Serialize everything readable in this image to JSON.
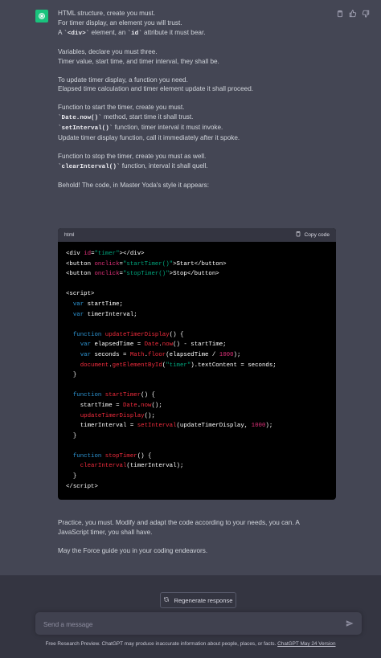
{
  "response": {
    "paragraphs": [
      [
        {
          "t": "HTML structure, create you must."
        },
        {
          "t": "For timer display, an element you will trust."
        },
        {
          "parts": [
            {
              "t": "A "
            },
            {
              "c": "`<div>`"
            },
            {
              "t": " element, an "
            },
            {
              "c": "`id`"
            },
            {
              "t": " attribute it must bear."
            }
          ]
        }
      ],
      [
        {
          "t": "Variables, declare you must three."
        },
        {
          "t": "Timer value, start time, and timer interval, they shall be."
        }
      ],
      [
        {
          "t": "To update timer display, a function you need."
        },
        {
          "t": "Elapsed time calculation and timer element update it shall proceed."
        }
      ],
      [
        {
          "t": "Function to start the timer, create you must."
        },
        {
          "parts": [
            {
              "c": "`Date.now()`"
            },
            {
              "t": " method, start time it shall trust."
            }
          ]
        },
        {
          "parts": [
            {
              "c": "`setInterval()`"
            },
            {
              "t": " function, timer interval it must invoke."
            }
          ]
        },
        {
          "t": "Update timer display function, call it immediately after it spoke."
        }
      ],
      [
        {
          "t": "Function to stop the timer, create you must as well."
        },
        {
          "parts": [
            {
              "c": "`clearInterval()`"
            },
            {
              "t": " function, interval it shall quell."
            }
          ]
        }
      ],
      [
        {
          "t": "Behold! The code, in Master Yoda's style it appears:"
        }
      ]
    ],
    "code": {
      "language": "html",
      "copy_label": "Copy code"
    },
    "after": {
      "line1": "Practice, you must. Modify and adapt the code according to your needs, you can. A",
      "line2": "JavaScript timer, you shall have.",
      "line3": "May the Force guide you in your coding endeavors."
    }
  },
  "icons": {
    "avatar": "openai-logo-icon",
    "copy": "clipboard-icon",
    "thumbs_up": "thumbs-up-icon",
    "thumbs_down": "thumbs-down-icon",
    "regenerate": "refresh-icon",
    "send": "send-icon"
  },
  "controls": {
    "regenerate_label": "Regenerate response",
    "input_placeholder": "Send a message"
  },
  "footer": {
    "text": "Free Research Preview. ChatGPT may produce inaccurate information about people, places, or facts.",
    "link": "ChatGPT May 24 Version"
  },
  "colors": {
    "page_bg": "#444654",
    "bottom_bg": "#343541",
    "avatar_bg": "#19c37d",
    "code_bg": "#000000",
    "code_header_bg": "#343541"
  }
}
